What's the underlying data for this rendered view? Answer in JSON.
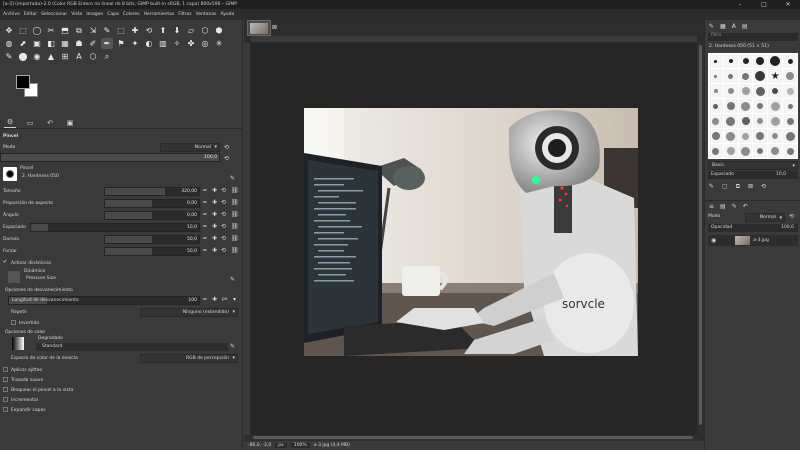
{
  "window": {
    "title": "[a-3] (importada)-2.0 (Color RGB Entero no lineal de 8 bits, GIMP built-in sRGB, 1 capa) 800x596 – GIMP",
    "controls": [
      "–",
      "□",
      "✕"
    ]
  },
  "menu": [
    "Archivo",
    "Editar",
    "Seleccionar",
    "Vista",
    "Imagen",
    "Capa",
    "Colores",
    "Herramientas",
    "Filtros",
    "Ventanas",
    "Ayuda"
  ],
  "tools": [
    [
      "✥",
      "⬚",
      "◯",
      "✂",
      "⬒",
      "⧉",
      "⇲",
      "✎",
      "⬚",
      "✚",
      "⟲",
      "⬆",
      "⬇",
      "▱",
      "⬡",
      "⬢"
    ],
    [
      "◍",
      "⬈",
      "▣",
      "◧",
      "▦",
      "☗",
      "✐",
      "✒",
      "⚑",
      "✦",
      "◐",
      "▥",
      "✧",
      "✤",
      "◎",
      "✳"
    ],
    [
      "✎",
      "⬤",
      "◉",
      "▲",
      "⊞",
      "A",
      "⬡",
      "⌕"
    ]
  ],
  "tool_options": {
    "header": "Pincel",
    "mode_label": "Modo",
    "mode_value": "Normal",
    "opacity_label": "Opacidad",
    "opacity_value": "100,0",
    "brush_label": "Pincel",
    "brush_name": "2. Hardness 050",
    "size_label": "Tamaño",
    "size_value": "320,00",
    "aspect_label": "Proporción de aspecto",
    "aspect_value": "0,00",
    "angle_label": "Ángulo",
    "angle_value": "0,00",
    "spacing_label": "Espaciado",
    "spacing_value": "10,0",
    "hardness_label": "Dureza",
    "hardness_value": "50,0",
    "force_label": "Forzar",
    "force_value": "50,0",
    "dynamics_toggle": "Activar dinámicas",
    "dynamics_label": "Dinámica",
    "dynamics_value": "Pressure Size",
    "fade_section": "Opciones de desvanecimiento",
    "fade_length_label": "Longitud de desvanecimiento",
    "fade_length_value": "100",
    "fade_unit": "px",
    "repeat_label": "Repetir",
    "repeat_value": "Ninguno (extendido)",
    "reverse_label": "Invertido",
    "color_section": "Opciones de color",
    "gradient_label": "Degradado",
    "gradient_value": "Standard",
    "blend_space_label": "Espacio de color de la mezcla",
    "blend_space_value": "RGB de percepción",
    "jitter_label": "Aplicar ajitteo",
    "smooth_label": "Trazado suave",
    "lock_label": "Bloquear el pincel a la vista",
    "incremental_label": "Incremental",
    "expand_label": "Expandir capas"
  },
  "status": {
    "coords": "-86,0, -2,0",
    "unit": "px",
    "zoom": "100%",
    "file": "a-3.jpg (4,4 MB)"
  },
  "right_dock": {
    "brush_filter_placeholder": "filtro",
    "brush_title": "2. Hardness 050 (51 × 51)",
    "brush_tag": "Basic.",
    "spacing_label": "Espaciado",
    "spacing_value": "10,0",
    "layers_mode_label": "Modo",
    "layers_mode_value": "Normal",
    "layers_opacity_label": "Opacidad",
    "layers_opacity_value": "100,0",
    "layer_name": "a-3.jpg"
  },
  "colors": {
    "fg": "#000000",
    "bg": "#ffffff",
    "ui_bg": "#3a3a3a",
    "canvas_bg": "#262626"
  }
}
